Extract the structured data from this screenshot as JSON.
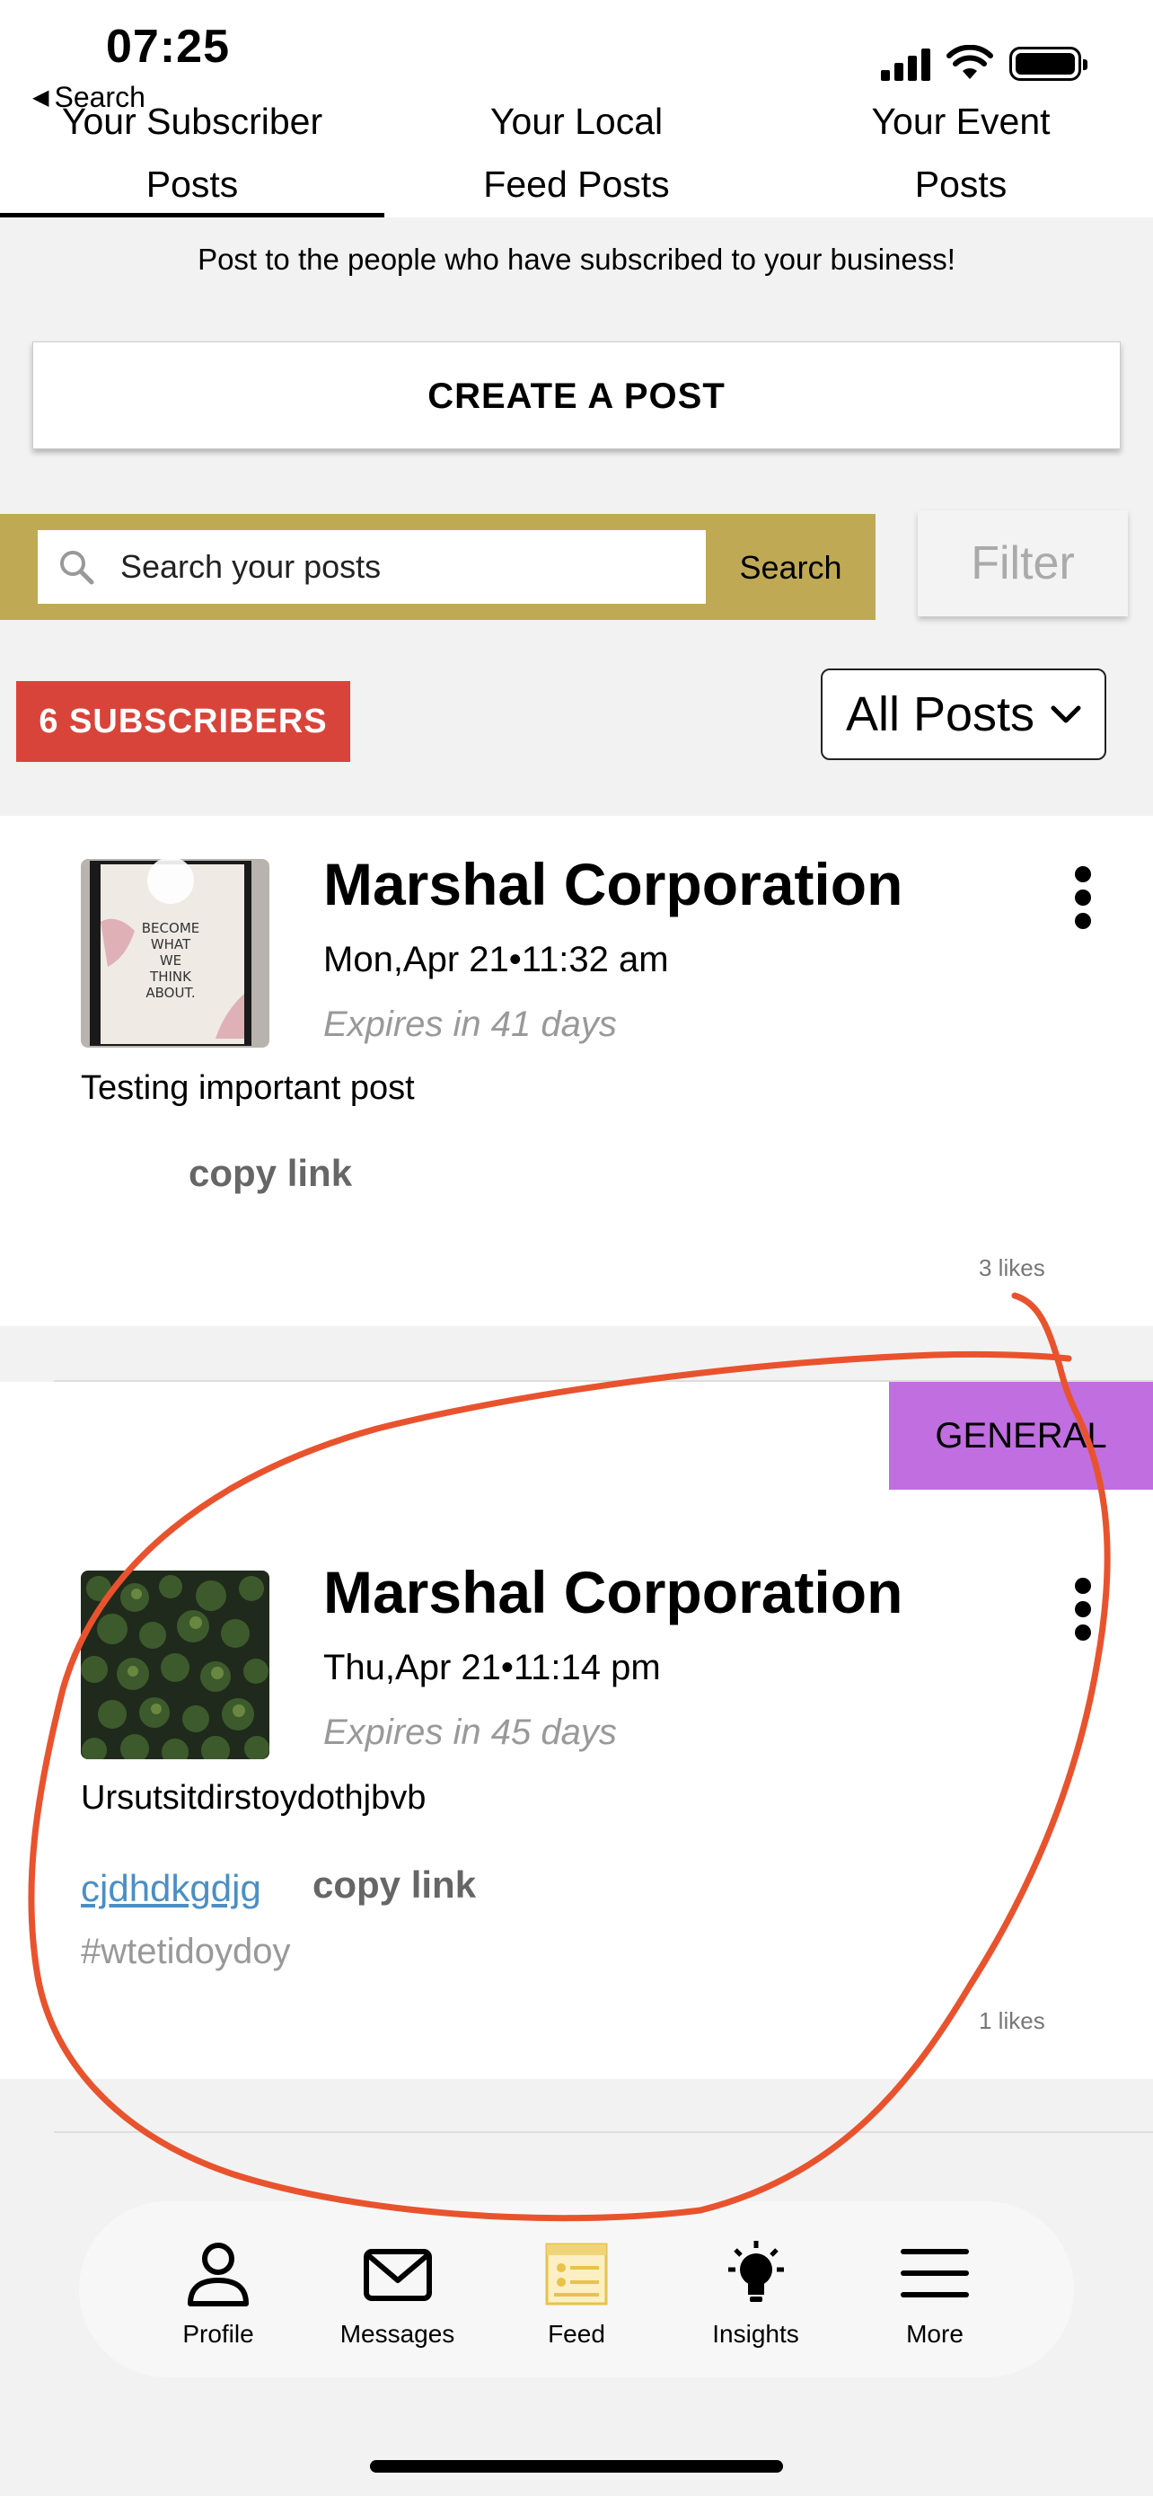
{
  "status_bar": {
    "time": "07:25",
    "back_label": "Search"
  },
  "tabs": [
    {
      "line1": "Your Subscriber",
      "line2": "Posts",
      "active": true
    },
    {
      "line1": "Your Local",
      "line2": "Feed Posts",
      "active": false
    },
    {
      "line1": "Your Event",
      "line2": "Posts",
      "active": false
    }
  ],
  "intro_text": "Post to the people who have subscribed to your business!",
  "create_post_label": "CREATE A POST",
  "search": {
    "placeholder": "Search your posts",
    "button_label": "Search"
  },
  "filter_label": "Filter",
  "subscribers_badge": "6 SUBSCRIBERS",
  "posts_filter": {
    "selected": "All Posts"
  },
  "posts": [
    {
      "company": "Marshal Corporation",
      "date": "Mon,Apr 21•11:32 am",
      "expires": "Expires in 41 days",
      "body": "Testing important post",
      "copy_link": "copy link",
      "likes": "3 likes",
      "thumbnail": "poster-image"
    },
    {
      "company": "Marshal Corporation",
      "date": "Thu,Apr 21•11:14 pm",
      "expires": "Expires in 45 days",
      "body": "Ursutsitdirstoydothjbvb",
      "link_text": "cjdhdkgdjg",
      "copy_link": "copy link",
      "hashtag": "#wtetidoydoy",
      "likes": "1 likes",
      "category": "GENERAL",
      "thumbnail": "forest-image"
    }
  ],
  "tabbar": [
    {
      "label": "Profile",
      "icon": "person-icon"
    },
    {
      "label": "Messages",
      "icon": "envelope-icon"
    },
    {
      "label": "Feed",
      "icon": "feed-icon"
    },
    {
      "label": "Insights",
      "icon": "lightbulb-icon"
    },
    {
      "label": "More",
      "icon": "menu-icon"
    }
  ],
  "colors": {
    "search_bar": "#bfa955",
    "subscribers_badge": "#d9443a",
    "general_badge": "#c06ee0",
    "annotation": "#e8532e",
    "link": "#4a8fc4"
  }
}
